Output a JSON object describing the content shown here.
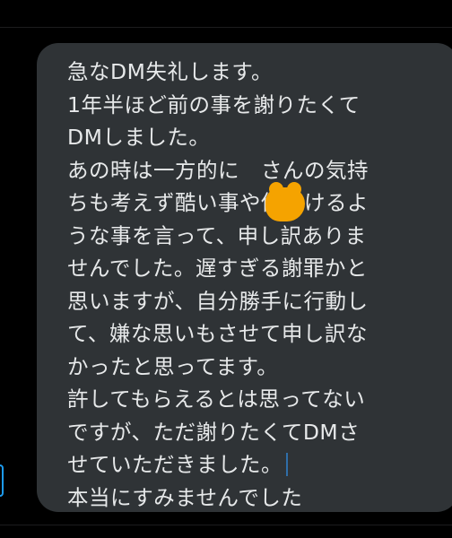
{
  "message": {
    "lines": [
      "急なDM失礼します。",
      "1年半ほど前の事を謝りたくて",
      "DMしました。",
      "あの時は一方的に　さんの気持",
      "ちも考えず酷い事や傷つけるよ",
      "うな事を言って、申し訳ありま",
      "せんでした。遅すぎる謝罪かと",
      "思いますが、自分勝手に行動し",
      "て、嫌な思いもさせて申し訳な",
      "かったと思ってます。",
      "許してもらえるとは思ってない",
      "ですが、ただ謝りたくてDMさ",
      "せていただきました。",
      "本当にすみませんでした"
    ]
  },
  "colors": {
    "background": "#000000",
    "bubble": "#2f3336",
    "text": "#e7e9ea",
    "redaction": "#f5a300",
    "accent": "#1d9bf0"
  }
}
